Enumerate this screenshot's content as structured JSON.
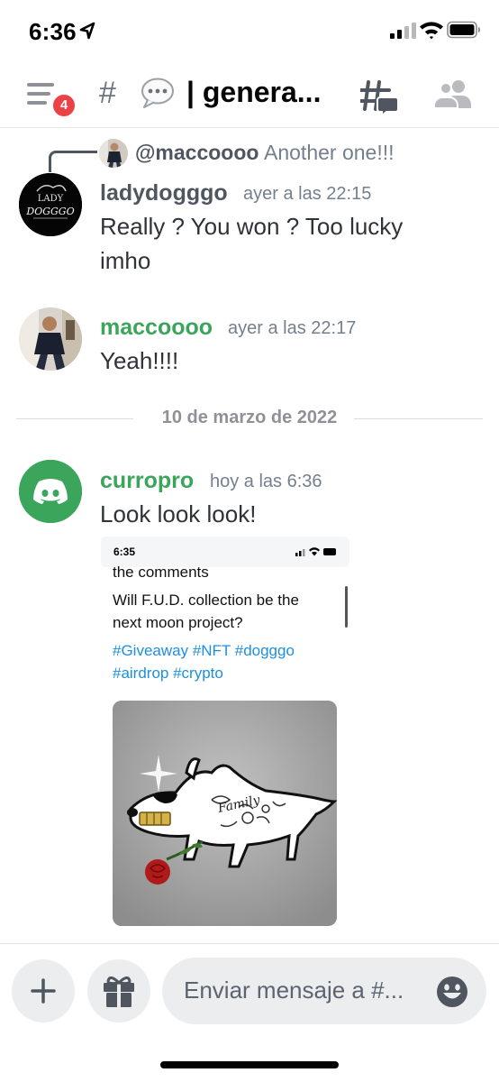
{
  "status_bar": {
    "time": "6:36"
  },
  "channel_header": {
    "hash": "#",
    "channel_name": "| genera...",
    "unread_badge": "4"
  },
  "reply": {
    "author": "@maccoooo",
    "text": "Another one!!!"
  },
  "messages": [
    {
      "author": "ladydogggo",
      "author_color": "#4f5660",
      "timestamp": "ayer a las 22:15",
      "lines": [
        "Really ? You won ? Too lucky",
        "imho"
      ],
      "avatar_text": [
        "LADY",
        "DOGGGO"
      ]
    },
    {
      "author": "maccoooo",
      "author_color": "#3ba55c",
      "timestamp": "ayer a las 22:17",
      "lines": [
        "Yeah!!!!"
      ]
    },
    {
      "author": "curropro",
      "author_color": "#3ba55c",
      "timestamp": "hoy a las 6:36",
      "lines": [
        "Look look look!"
      ]
    }
  ],
  "date_divider": "10 de marzo de 2022",
  "attachment": {
    "time": "6:35",
    "line_comments": "the comments",
    "line1": "Will F.U.D. collection be the",
    "line2": "next moon project?",
    "hashtags1": "#Giveaway #NFT #dogggo",
    "hashtags2": "#airdrop #crypto",
    "nft_text": "Family"
  },
  "composer": {
    "placeholder": "Enviar mensaje a #..."
  },
  "colors": {
    "accent_green": "#3ba55c",
    "badge_red": "#ed4245",
    "hashtag_blue": "#1d8fe0"
  }
}
